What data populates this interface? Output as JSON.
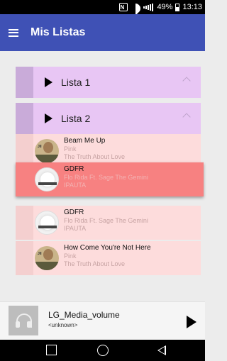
{
  "status_bar": {
    "nfc": "N",
    "battery": "49%",
    "time": "13:13",
    "icons": [
      "nfc-icon",
      "wifi-icon",
      "signal-icon",
      "battery-icon"
    ]
  },
  "app_bar": {
    "menu_icon": "hamburger-icon",
    "title": "Mis Listas",
    "color": "#3f51b5"
  },
  "lists": [
    {
      "label": "Lista 1",
      "expanded": false
    },
    {
      "label": "Lista 2",
      "expanded": true
    }
  ],
  "tracks": [
    {
      "title": "Beam Me Up",
      "artist": "Pink",
      "album": "The Truth About Love",
      "art": "pink-album-art"
    },
    {
      "title": "GDFR",
      "artist": "Flo Rida Ft. Sage The Gemini",
      "album": "IPAUTA",
      "art": "flo-rida-album-art",
      "active": true
    },
    {
      "title": "GDFR",
      "artist": "Flo Rida Ft. Sage The Gemini",
      "album": "IPAUTA",
      "art": "flo-rida-album-art"
    },
    {
      "title": "How Come You're Not Here",
      "artist": "Pink",
      "album": "The Truth About Love",
      "art": "pink-album-art"
    }
  ],
  "player": {
    "title": "LG_Media_volume",
    "subtitle": "<unknown>",
    "thumb_icon": "headphones-icon",
    "play_icon": "play-icon"
  },
  "nav_bar": {
    "buttons": [
      "recent-apps-icon",
      "home-icon",
      "back-icon"
    ]
  },
  "colors": {
    "group_header": "#e8c6f4",
    "track_row": "#fddcdc",
    "track_active": "#f78181"
  }
}
